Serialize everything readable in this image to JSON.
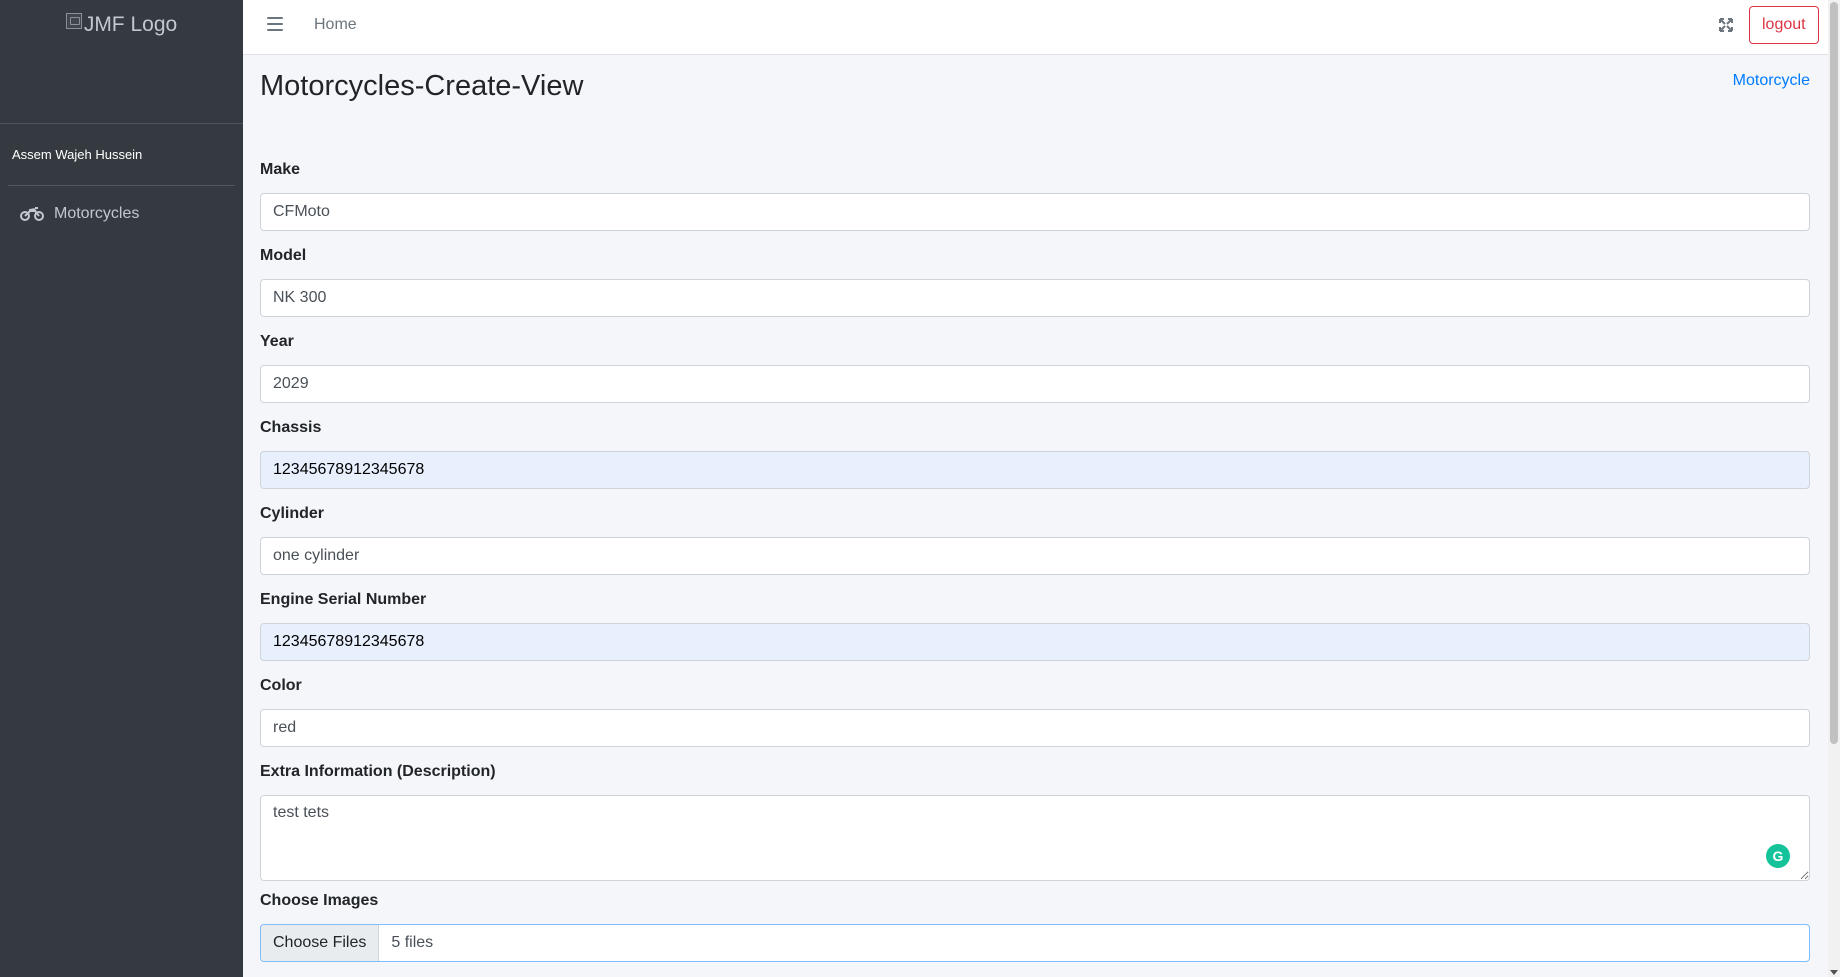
{
  "brand": {
    "logo_alt": "JMF Logo"
  },
  "user": {
    "name": "Assem Wajeh Hussein"
  },
  "sidebar": {
    "items": [
      {
        "label": "Motorcycles",
        "icon": "motorcycle-icon"
      }
    ]
  },
  "topbar": {
    "home_label": "Home",
    "logout_label": "logout"
  },
  "page": {
    "title": "Motorcycles-Create-View",
    "breadcrumb": "Motorcycle"
  },
  "form": {
    "make": {
      "label": "Make",
      "value": "CFMoto"
    },
    "model": {
      "label": "Model",
      "value": "NK 300"
    },
    "year": {
      "label": "Year",
      "value": "2029"
    },
    "chassis": {
      "label": "Chassis",
      "value": "12345678912345678"
    },
    "cylinder": {
      "label": "Cylinder",
      "value": "one cylinder"
    },
    "engine_serial": {
      "label": "Engine Serial Number",
      "value": "12345678912345678"
    },
    "color": {
      "label": "Color",
      "value": "red"
    },
    "description": {
      "label": "Extra Information (Description)",
      "value": "test tets"
    },
    "images": {
      "label": "Choose Images",
      "button_label": "Choose Files",
      "status": "5 files"
    }
  },
  "colors": {
    "sidebar_bg": "#343a40",
    "accent": "#007bff",
    "danger": "#dc3545",
    "autofill_bg": "#e8f0fe"
  }
}
